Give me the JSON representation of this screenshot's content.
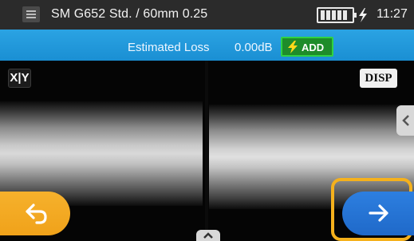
{
  "status_bar": {
    "mode_title": "SM G652 Std. / 60mm 0.25",
    "clock": "11:27",
    "icons": [
      "menu-icon",
      "battery-icon",
      "charging-icon"
    ]
  },
  "loss_bar": {
    "label": "Estimated Loss",
    "value": "0.00dB",
    "add_button": {
      "label": "ADD",
      "icon": "lightning-icon",
      "color": "#1e8c2a"
    }
  },
  "view": {
    "xy_button": "X|Y",
    "disp_button": "DISP",
    "back_button_icon": "undo-arrow-icon",
    "next_button_icon": "right-arrow-icon"
  },
  "colors": {
    "accent_blue": "#1a8fd3",
    "back_orange": "#f0a21a",
    "next_blue": "#1f69c9",
    "highlight": "#f5b11c"
  }
}
